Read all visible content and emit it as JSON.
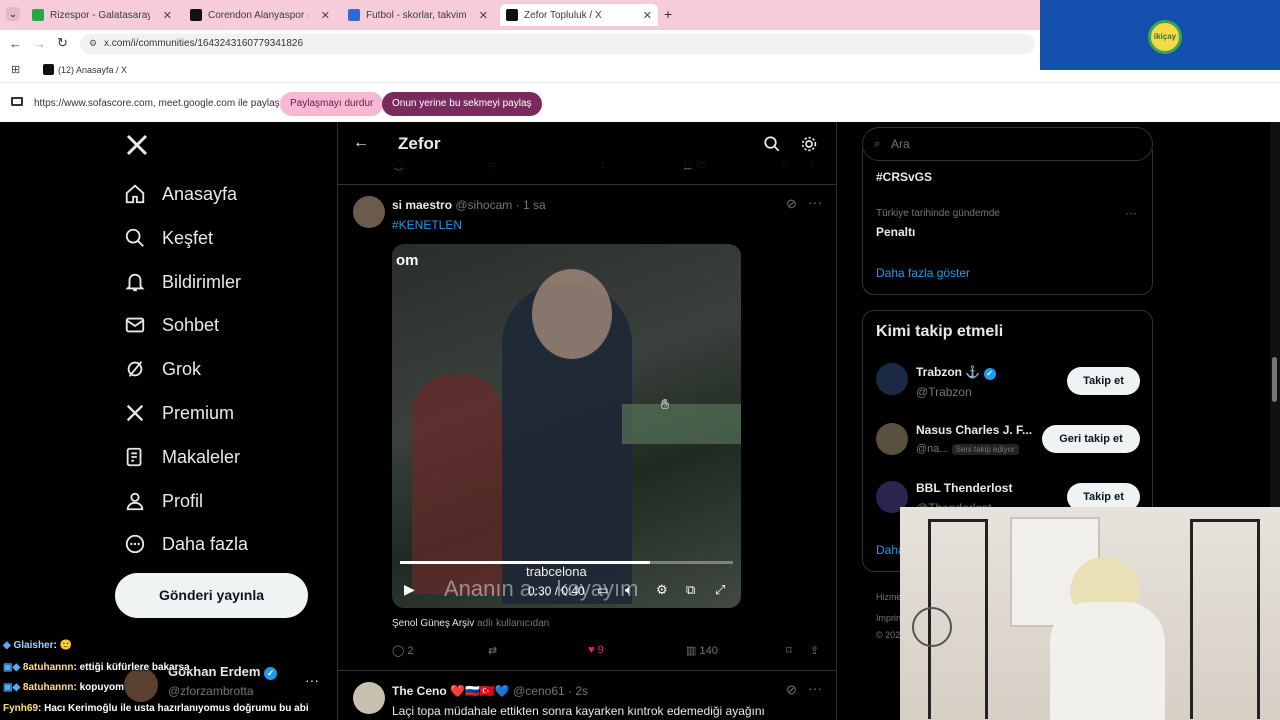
{
  "browser": {
    "tabs": [
      {
        "label": "Rizespor - Galatasaray canlı skor",
        "fav_color": "#2aa34a"
      },
      {
        "label": "Corendon Alanyaspor 🌊🟠 (@",
        "fav_color": "#111111"
      },
      {
        "label": "Futbol - skorlar, takvim & e",
        "fav_color": "#3367d6"
      },
      {
        "label": "Zefor Topluluk / X",
        "fav_color": "#111111"
      }
    ],
    "url": "x.com/i/communities/1643243160779341826",
    "bookmark": "(12) Anasayfa / X",
    "share_text": "https://www.sofascore.com, meet.google.com ile paylaşılıyor",
    "stop_share": "Paylaşmayı durdur",
    "share_this_tab": "Onun yerine bu sekmeyi paylaş",
    "ad_logo": "ikiçay"
  },
  "sidebar": {
    "items": [
      {
        "label": "Anasayfa",
        "icon": "home-icon"
      },
      {
        "label": "Keşfet",
        "icon": "search-icon"
      },
      {
        "label": "Bildirimler",
        "icon": "bell-icon"
      },
      {
        "label": "Sohbet",
        "icon": "mail-icon"
      },
      {
        "label": "Grok",
        "icon": "grok-icon"
      },
      {
        "label": "Premium",
        "icon": "x-icon"
      },
      {
        "label": "Makaleler",
        "icon": "article-icon"
      },
      {
        "label": "Profil",
        "icon": "person-icon"
      },
      {
        "label": "Daha fazla",
        "icon": "more-icon"
      }
    ],
    "post_button": "Gönderi yayınla",
    "account_name": "Gökhan Erdem",
    "account_handle": "@zforzambrotta"
  },
  "main": {
    "title": "Zefor",
    "prev_post": {
      "views": "45",
      "replies": "",
      "likes": "1"
    },
    "post": {
      "name": "si maestro",
      "handle": "@sihocam",
      "time": "1 sa",
      "text": "#KENETLEN",
      "video_time": "0:30 / 0:40",
      "video_watermark": "trabcelona",
      "video_corner": "om",
      "video_subtitle": "Ananın a... koyayım",
      "video_progress": 0.75,
      "source": "Şenol Güneş Arşiv",
      "source_suffix": "adlı kullanıcıdan",
      "replies": "2",
      "likes": "9",
      "views": "140"
    },
    "next_post": {
      "name": "The Ceno",
      "flags": "❤️🇷🇺🇹🇷💙",
      "handle": "@ceno61",
      "time": "2s",
      "text": "Laçi topa müdahale ettikten sonra kayarken kıntrok edemediği ayağını"
    }
  },
  "right": {
    "search_placeholder": "Ara",
    "trend1": "#CRSvGS",
    "trend2_context": "Türkiye tarihinde gündemde",
    "trend2": "Penaltı",
    "show_more": "Daha fazla göster",
    "who_to_follow": "Kimi takip etmeli",
    "follow": [
      {
        "name": "Trabzon ⚓",
        "handle": "@Trabzon",
        "button": "Takip et",
        "note": ""
      },
      {
        "name": "Nasus Charles J. F...",
        "handle": "@na...",
        "button": "Geri takip et",
        "note": "Seni takip ediyor"
      },
      {
        "name": "BBL Thenderlost",
        "handle": "@Thenderlost",
        "button": "Takip et",
        "note": ""
      }
    ],
    "show_more_2": "Daha",
    "footer1": "Hizme",
    "footer2": "Imprin",
    "footer3": "© 202"
  },
  "chat": [
    {
      "user": "Glaisher",
      "text": ": 🙂",
      "color": "#9fd3ff"
    },
    {
      "user": "8atuhannn",
      "text": ": ettiği küfürlere bakarsa",
      "color": "#ffe07a"
    },
    {
      "user": "8atuhannn",
      "text": ": kopuyom",
      "color": "#ffe07a"
    },
    {
      "user": "Fynh69",
      "text": ": Hacı Kerimoğlu ile usta hazırlanıyomus doğrumu bu abi",
      "color": "#ffe07a"
    }
  ]
}
